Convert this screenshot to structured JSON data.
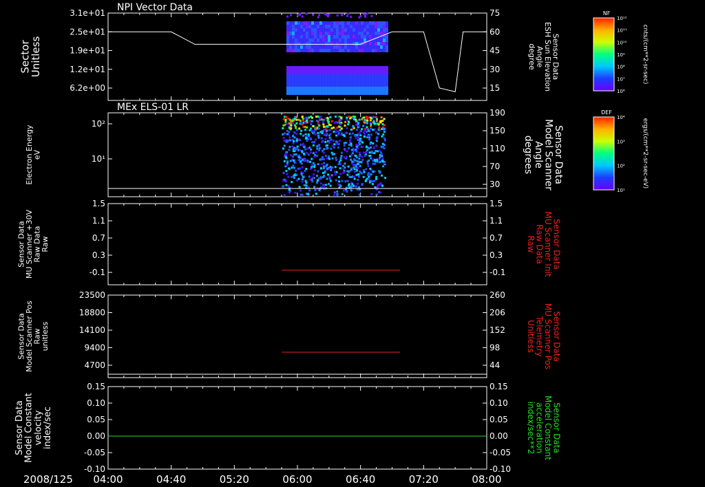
{
  "date_label": "2008/125",
  "x_ticks": [
    "04:00",
    "04:40",
    "05:20",
    "06:00",
    "06:40",
    "07:20",
    "08:00"
  ],
  "colors": {
    "white": "#ffffff",
    "red": "#e8231f",
    "green": "#22e022"
  },
  "chart_data": [
    {
      "type": "heatmap",
      "title": "NPI Vector Data",
      "ylabel": "Sector\nUnitless",
      "yticks": [
        "3.1e+01",
        "2.5e+01",
        "1.9e+01",
        "1.2e+01",
        "6.2e+00"
      ],
      "y2label": "Sensor Data\nESH Sun Elevation\nAngle\ndegree",
      "y2ticks": [
        "75",
        "60",
        "45",
        "30",
        "15"
      ],
      "colorbar": {
        "title": "NF",
        "unit": "cnts/(cm**2-sr-sec)",
        "ticks": [
          "10¹²",
          "10¹¹",
          "10¹⁰",
          "10⁹",
          "10⁸",
          "10⁷",
          "10⁶"
        ]
      },
      "line": {
        "x": [
          "04:00",
          "04:40",
          "04:55",
          "05:20",
          "05:40",
          "06:00",
          "06:20",
          "06:40",
          "07:00",
          "07:10",
          "07:20",
          "07:30",
          "07:40",
          "07:45",
          "08:00"
        ],
        "y": [
          60,
          60,
          50,
          50,
          50,
          50,
          50,
          50,
          60,
          60,
          60,
          15,
          12,
          60,
          60
        ]
      }
    },
    {
      "type": "heatmap",
      "title": "MEx ELS-01 LR",
      "ylabel": "Electron Energy\neV",
      "yticks": [
        "10²",
        "10¹"
      ],
      "y2label": "Sensor Data\nModel Scanner\nAngle\ndegrees",
      "y2ticks": [
        "190",
        "150",
        "110",
        "70",
        "30"
      ],
      "colorbar": {
        "title": "DEF",
        "unit": "ergs/(cm**2-sr-sec-eV)",
        "ticks": [
          "10⁴",
          "10³",
          "10²",
          "10¹"
        ]
      }
    },
    {
      "type": "line",
      "ylabel": "Sensor Data\nMU Scanner +30V\nRaw Data\nRaw",
      "yticks": [
        "1.5",
        "1.1",
        "0.7",
        "0.3",
        "-0.1"
      ],
      "y2label": "Sensor Data\nMU Scanner Init\nRaw Data\nRaw",
      "y2ticks": [
        "1.5",
        "1.1",
        "0.7",
        "0.3",
        "-0.1"
      ],
      "series": [
        {
          "x": [
            "05:50",
            "07:05"
          ],
          "y": [
            -0.05,
            -0.05
          ]
        }
      ]
    },
    {
      "type": "line",
      "ylabel": "Sensor Data\nModel Scanner Pos\nRaw\nunitless",
      "yticks": [
        "23500",
        "18800",
        "14100",
        "9400",
        "4700"
      ],
      "y2label": "Sensor Data\nMU Scanner Pos\nTelemetry\nUnitless",
      "y2ticks": [
        "260",
        "206",
        "152",
        "98",
        "44"
      ],
      "series": [
        {
          "x": [
            "05:50",
            "07:05"
          ],
          "y": [
            8200,
            8200
          ]
        }
      ]
    },
    {
      "type": "line",
      "ylabel": "Sensor Data\nModel Constant\nvelocity\nindex/sec",
      "yticks": [
        "0.15",
        "0.10",
        "0.05",
        "0.00",
        "-0.05",
        "-0.10"
      ],
      "y2label": "Sensor Data\nModel Constant\nacceleration\nindex/sec**2",
      "y2ticks": [
        "0.15",
        "0.10",
        "0.05",
        "0.00",
        "-0.05",
        "-0.10"
      ],
      "series": [
        {
          "x": [
            "04:00",
            "08:00"
          ],
          "y": [
            0,
            0
          ]
        }
      ]
    }
  ]
}
